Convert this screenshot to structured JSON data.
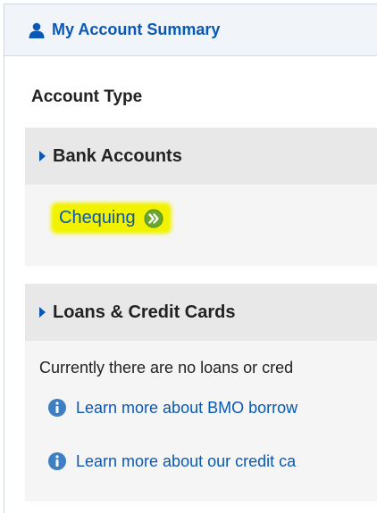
{
  "panel": {
    "title": "My Account Summary",
    "icon": "user-icon"
  },
  "account_type_label": "Account Type",
  "sections": {
    "bank": {
      "title": "Bank Accounts",
      "accounts": [
        {
          "label": "Chequing",
          "icon": "go-arrow-icon",
          "highlight_color": "#f2f200"
        }
      ]
    },
    "loans": {
      "title": "Loans & Credit Cards",
      "message": "Currently there are no loans or cred",
      "links": [
        {
          "label": "Learn more about BMO borrow",
          "icon": "info-icon"
        },
        {
          "label": "Learn more about our credit ca",
          "icon": "info-icon"
        }
      ]
    }
  },
  "colors": {
    "link": "#0a58b6",
    "header_bg": "#f1f4f8",
    "section_header_bg": "#e8e8e8",
    "section_bg": "#f5f5f5",
    "go_icon_green": "#6aa72e",
    "info_icon_blue": "#3e7fc4"
  }
}
